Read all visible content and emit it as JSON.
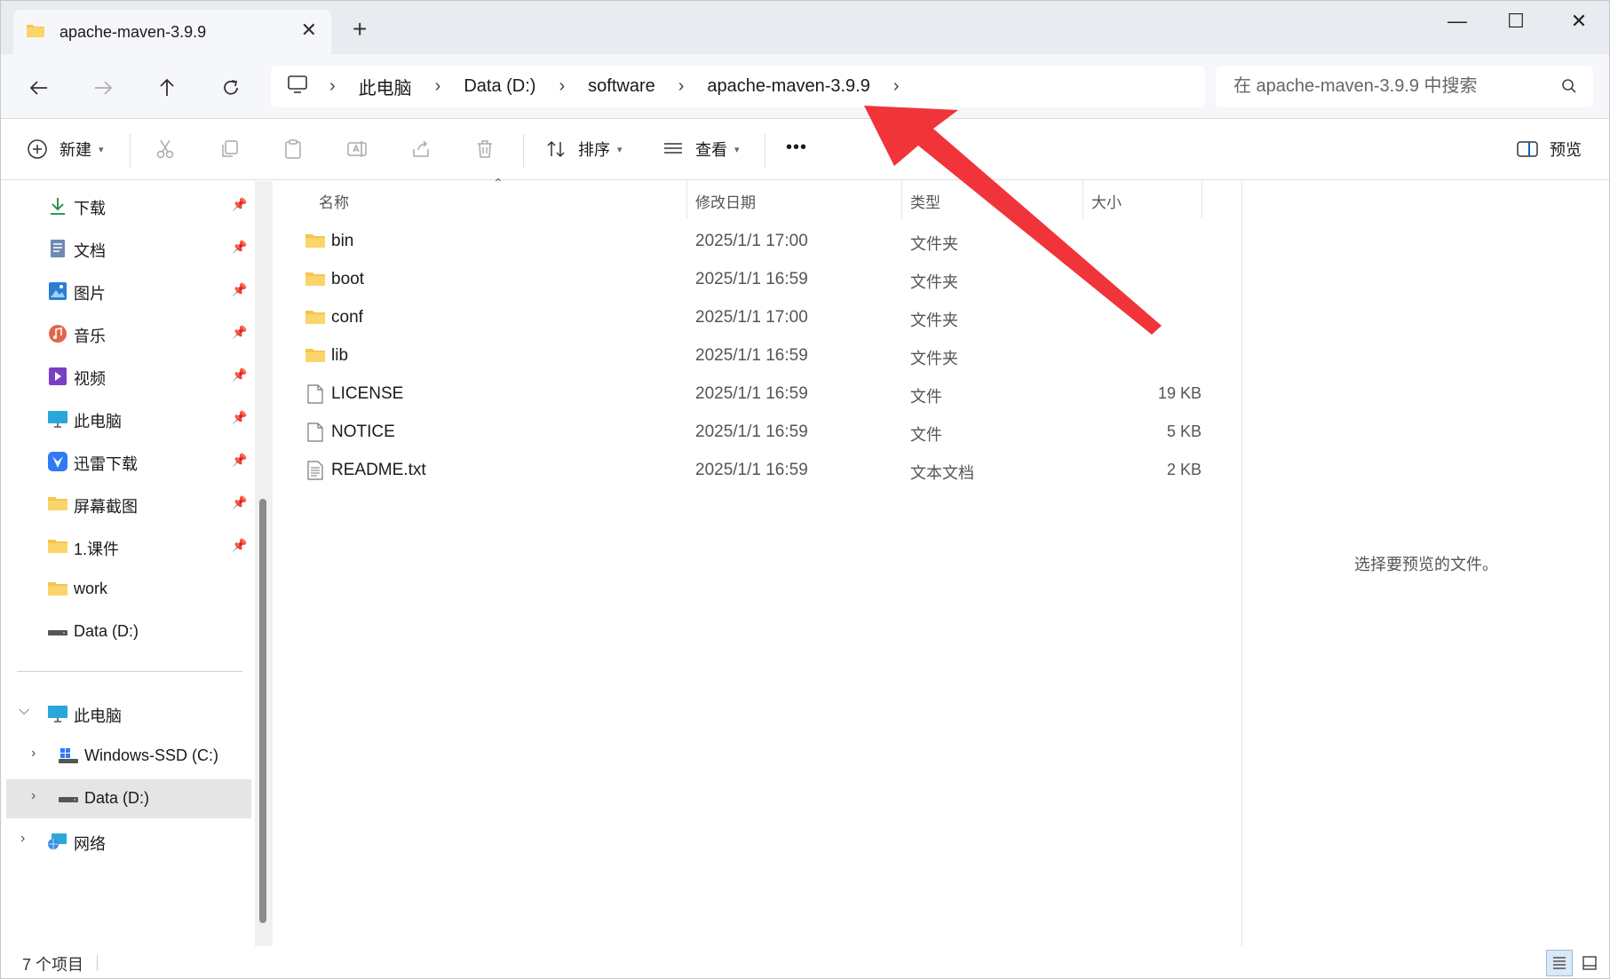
{
  "window": {
    "tab_title": "apache-maven-3.9.9",
    "tab_close": "✕",
    "new_tab": "+",
    "controls": {
      "minimize": "—",
      "maximize": "☐",
      "close": "✕"
    }
  },
  "nav": {
    "breadcrumb": [
      "此电脑",
      "Data (D:)",
      "software",
      "apache-maven-3.9.9"
    ],
    "separator": "›",
    "search_placeholder": "在 apache-maven-3.9.9 中搜索"
  },
  "toolbar": {
    "new_label": "新建",
    "sort_label": "排序",
    "view_label": "查看",
    "more_label": "•••",
    "preview_label": "预览"
  },
  "sidebar": {
    "quick_access": [
      {
        "label": "下载",
        "icon": "download-icon"
      },
      {
        "label": "文档",
        "icon": "document-icon"
      },
      {
        "label": "图片",
        "icon": "pictures-icon"
      },
      {
        "label": "音乐",
        "icon": "music-icon"
      },
      {
        "label": "视频",
        "icon": "video-icon"
      },
      {
        "label": "此电脑",
        "icon": "computer-icon"
      },
      {
        "label": "迅雷下载",
        "icon": "thunder-icon"
      },
      {
        "label": "屏幕截图",
        "icon": "folder-icon"
      },
      {
        "label": "1.课件",
        "icon": "folder-icon"
      },
      {
        "label": "work",
        "icon": "folder-icon"
      },
      {
        "label": "Data (D:)",
        "icon": "drive-icon"
      }
    ],
    "this_pc": "此电脑",
    "drives": [
      "Windows-SSD (C:)",
      "Data (D:)"
    ],
    "network": "网络"
  },
  "columns": {
    "name": "名称",
    "date": "修改日期",
    "type": "类型",
    "size": "大小"
  },
  "files": [
    {
      "name": "bin",
      "date": "2025/1/1 17:00",
      "type": "文件夹",
      "size": "",
      "kind": "folder"
    },
    {
      "name": "boot",
      "date": "2025/1/1 16:59",
      "type": "文件夹",
      "size": "",
      "kind": "folder"
    },
    {
      "name": "conf",
      "date": "2025/1/1 17:00",
      "type": "文件夹",
      "size": "",
      "kind": "folder"
    },
    {
      "name": "lib",
      "date": "2025/1/1 16:59",
      "type": "文件夹",
      "size": "",
      "kind": "folder"
    },
    {
      "name": "LICENSE",
      "date": "2025/1/1 16:59",
      "type": "文件",
      "size": "19 KB",
      "kind": "file"
    },
    {
      "name": "NOTICE",
      "date": "2025/1/1 16:59",
      "type": "文件",
      "size": "5 KB",
      "kind": "file"
    },
    {
      "name": "README.txt",
      "date": "2025/1/1 16:59",
      "type": "文本文档",
      "size": "2 KB",
      "kind": "text"
    }
  ],
  "preview": {
    "message": "选择要预览的文件。"
  },
  "status": {
    "count": "7 个项目"
  },
  "colors": {
    "annotation_arrow": "#f0343a",
    "folder": "#f6c54a",
    "accent": "#0067c0"
  }
}
